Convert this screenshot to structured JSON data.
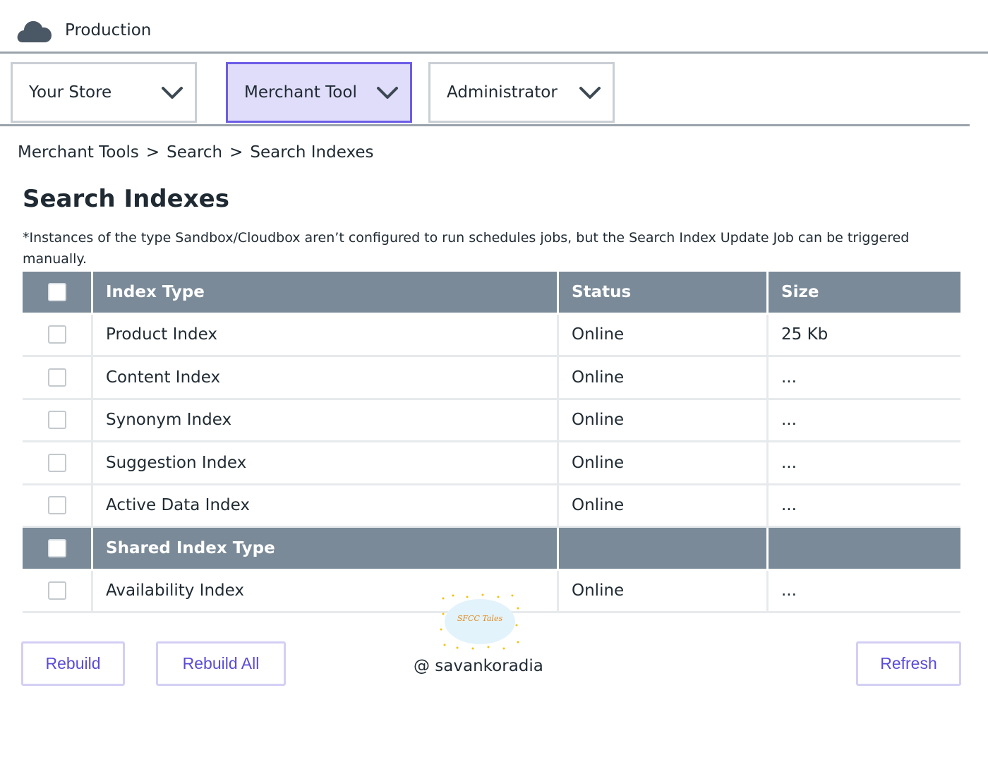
{
  "header": {
    "environment": "Production",
    "icon": "cloud-icon"
  },
  "nav": [
    {
      "label": "Your Store",
      "active": false
    },
    {
      "label": "Merchant Tool",
      "active": true
    },
    {
      "label": "Administrator",
      "active": false
    }
  ],
  "breadcrumb": {
    "items": [
      "Merchant Tools",
      "Search",
      "Search Indexes"
    ],
    "separator": ">"
  },
  "page": {
    "title": "Search Indexes",
    "note": "*Instances of the type Sandbox/Cloudbox aren’t configured to run schedules jobs, but the Search Index Update Job can be triggered manually."
  },
  "table": {
    "headers": {
      "type": "Index Type",
      "status": "Status",
      "size": "Size"
    },
    "rows": [
      {
        "type": "Product Index",
        "status": "Online",
        "size": "25 Kb"
      },
      {
        "type": "Content Index",
        "status": "Online",
        "size": "..."
      },
      {
        "type": "Synonym Index",
        "status": "Online",
        "size": "..."
      },
      {
        "type": "Suggestion Index",
        "status": "Online",
        "size": "..."
      },
      {
        "type": "Active Data Index",
        "status": "Online",
        "size": "..."
      }
    ],
    "shared_header": "Shared Index Type",
    "shared_rows": [
      {
        "type": "Availability Index",
        "status": "Online",
        "size": "..."
      }
    ]
  },
  "watermark": {
    "logo_text": "SFCC Tales",
    "credit": "@ savankoradia"
  },
  "actions": {
    "rebuild": "Rebuild",
    "rebuild_all": "Rebuild All",
    "refresh": "Refresh"
  },
  "colors": {
    "accent": "#5a4bd8",
    "active_tab_bg": "#e0ddfb",
    "header_bg": "#7a8a98"
  }
}
